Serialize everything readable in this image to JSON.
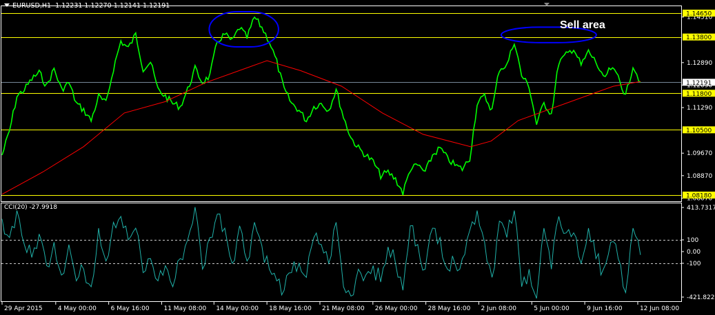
{
  "header": {
    "symbol": "EURUSD,H1",
    "ohlc": "1.12231 1.12270 1.12141 1.12191"
  },
  "annotation": {
    "sell_label": "Sell area"
  },
  "cci": {
    "label": "CCI(20) -27.9918"
  },
  "colors": {
    "price": "#00ff00",
    "ma": "#ff0000",
    "levels": "#ffff00",
    "cci": "#20b2aa",
    "ellipse": "#0000ff",
    "axis": "#ffffff"
  },
  "chart_data": [
    {
      "type": "line",
      "title": "EURUSD,H1",
      "ylim": [
        1.0807,
        1.1469
      ],
      "xlim": [
        0,
        100
      ],
      "x_tick_labels": [
        {
          "at": 0,
          "label": "29 Apr 2015"
        },
        {
          "at": 7.9,
          "label": "4 May 00:00"
        },
        {
          "at": 15.7,
          "label": "6 May 16:00"
        },
        {
          "at": 23.5,
          "label": "11 May 08:00"
        },
        {
          "at": 31.2,
          "label": "14 May 00:00"
        },
        {
          "at": 39.0,
          "label": "18 May 16:00"
        },
        {
          "at": 46.8,
          "label": "21 May 08:00"
        },
        {
          "at": 54.6,
          "label": "26 May 00:00"
        },
        {
          "at": 62.4,
          "label": "28 May 16:00"
        },
        {
          "at": 70.2,
          "label": "2 Jun 08:00"
        },
        {
          "at": 78.0,
          "label": "5 Jun 00:00"
        },
        {
          "at": 85.8,
          "label": "9 Jun 16:00"
        },
        {
          "at": 93.6,
          "label": "12 Jun 08:00"
        }
      ],
      "y_tick_labels": [
        "1.14510",
        "1.12890",
        "1.12090",
        "1.11290",
        "1.09670",
        "1.08870",
        "1.08070"
      ],
      "y_ticks": [
        1.1451,
        1.1289,
        1.1209,
        1.1129,
        1.0967,
        1.0887,
        1.0807
      ],
      "levels": [
        {
          "value": 1.1465,
          "label": "1.14650"
        },
        {
          "value": 1.138,
          "label": "1.13800"
        },
        {
          "value": 1.118,
          "label": "1.11800"
        },
        {
          "value": 1.105,
          "label": "1.10500"
        },
        {
          "value": 1.0818,
          "label": "1.08180"
        }
      ],
      "current_price": {
        "value": 1.12191,
        "label": "1.12191"
      },
      "series": [
        {
          "name": "EURUSD close",
          "x_range": [
            0,
            94
          ],
          "values": [
            1.096,
            1.1046,
            1.1169,
            1.1193,
            1.123,
            1.1254,
            1.1205,
            1.1267,
            1.1193,
            1.1218,
            1.1144,
            1.112,
            1.1083,
            1.1169,
            1.1144,
            1.1267,
            1.1365,
            1.134,
            1.1389,
            1.1267,
            1.1291,
            1.1193,
            1.1169,
            1.1144,
            1.1132,
            1.1193,
            1.1267,
            1.1218,
            1.1242,
            1.1365,
            1.1389,
            1.1365,
            1.1414,
            1.1377,
            1.145,
            1.1414,
            1.1365,
            1.1291,
            1.1193,
            1.1144,
            1.112,
            1.1083,
            1.1132,
            1.1144,
            1.112,
            1.1193,
            1.1095,
            1.1022,
            1.0985,
            1.096,
            1.0936,
            1.0887,
            1.0899,
            1.0875,
            1.0826,
            1.0911,
            1.0924,
            1.0899,
            1.096,
            1.0985,
            1.0948,
            1.0924,
            1.0911,
            1.0948,
            1.1144,
            1.1169,
            1.112,
            1.1267,
            1.1279,
            1.1365,
            1.1242,
            1.1205,
            1.1071,
            1.1144,
            1.1107,
            1.1291,
            1.1316,
            1.134,
            1.1279,
            1.1328,
            1.1291,
            1.123,
            1.1267,
            1.1242,
            1.1169,
            1.1279,
            1.1219
          ]
        },
        {
          "name": "Moving average",
          "points": [
            [
              0,
              1.0821
            ],
            [
              6,
              1.09
            ],
            [
              12,
              1.099
            ],
            [
              18,
              1.111
            ],
            [
              24,
              1.115
            ],
            [
              30,
              1.1218
            ],
            [
              36,
              1.127
            ],
            [
              39,
              1.1296
            ],
            [
              44,
              1.126
            ],
            [
              50,
              1.1205
            ],
            [
              56,
              1.111
            ],
            [
              62,
              1.1034
            ],
            [
              69,
              1.099
            ],
            [
              72,
              1.101
            ],
            [
              76,
              1.1083
            ],
            [
              83,
              1.1144
            ],
            [
              90,
              1.1205
            ],
            [
              94,
              1.1222
            ]
          ]
        }
      ],
      "ellipses": [
        {
          "x": [
            30.5,
            40.7
          ],
          "y": [
            1.147,
            1.1345
          ]
        },
        {
          "x": [
            73.5,
            87.5
          ],
          "y": [
            1.1415,
            1.136
          ]
        }
      ]
    },
    {
      "type": "line",
      "title": "CCI(20) -27.9918",
      "ylim": [
        -421.8225,
        413.7317
      ],
      "y_tick_labels": [
        "413.7317",
        "100",
        "0.00",
        "-100",
        "-421.8225"
      ],
      "levels": [
        100,
        -100
      ],
      "series": [
        {
          "name": "CCI(20)",
          "x_range": [
            0,
            94
          ],
          "values": [
            280,
            120,
            350,
            60,
            -50,
            150,
            -120,
            80,
            -200,
            60,
            -250,
            -150,
            -300,
            200,
            -80,
            250,
            300,
            100,
            200,
            -180,
            -60,
            -250,
            -120,
            -300,
            -60,
            100,
            380,
            -150,
            120,
            320,
            200,
            -100,
            220,
            -80,
            250,
            50,
            -150,
            -250,
            -330,
            -180,
            -100,
            -220,
            120,
            60,
            -100,
            250,
            -300,
            -380,
            -150,
            -200,
            -120,
            -260,
            40,
            -100,
            -330,
            220,
            60,
            -150,
            200,
            120,
            -150,
            -100,
            -60,
            180,
            350,
            80,
            -220,
            260,
            120,
            350,
            -300,
            -150,
            -400,
            200,
            -150,
            300,
            160,
            160,
            -100,
            200,
            -60,
            -150,
            80,
            -60,
            -350,
            200,
            -28
          ]
        }
      ]
    }
  ]
}
